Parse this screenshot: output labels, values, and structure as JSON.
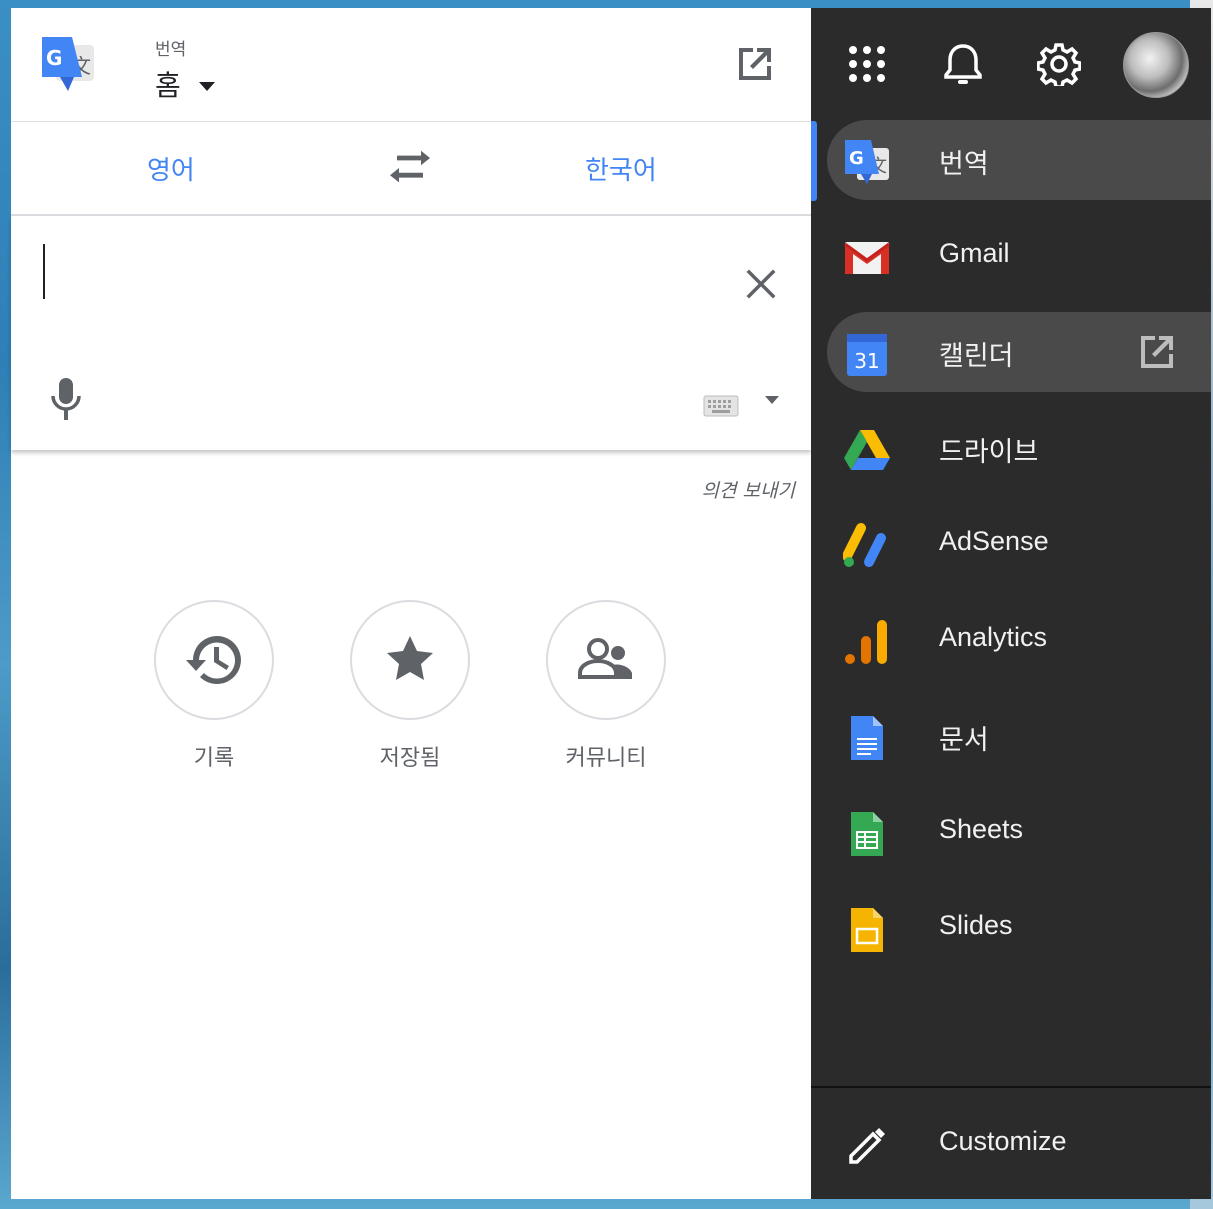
{
  "header": {
    "subtitle": "번역",
    "title": "홈"
  },
  "languages": {
    "source": "영어",
    "target": "한국어"
  },
  "input": {
    "placeholder": ""
  },
  "feedback": "의견 보내기",
  "actions": [
    {
      "label": "기록",
      "icon": "history-icon"
    },
    {
      "label": "저장됨",
      "icon": "star-icon"
    },
    {
      "label": "커뮤니티",
      "icon": "community-icon"
    }
  ],
  "drawer": {
    "items": [
      {
        "label": "번역",
        "icon": "google-translate-icon",
        "active": true
      },
      {
        "label": "Gmail",
        "icon": "gmail-icon"
      },
      {
        "label": "캘린더",
        "icon": "calendar-icon",
        "calendar_day": "31",
        "hovered": true
      },
      {
        "label": "드라이브",
        "icon": "drive-icon"
      },
      {
        "label": "AdSense",
        "icon": "adsense-icon"
      },
      {
        "label": "Analytics",
        "icon": "analytics-icon"
      },
      {
        "label": "문서",
        "icon": "docs-icon"
      },
      {
        "label": "Sheets",
        "icon": "sheets-icon"
      },
      {
        "label": "Slides",
        "icon": "slides-icon"
      }
    ],
    "customize": "Customize"
  },
  "colors": {
    "accent": "#4285f4",
    "drawer_bg": "#2b2b2b",
    "drawer_highlight": "#4a4a4a"
  }
}
